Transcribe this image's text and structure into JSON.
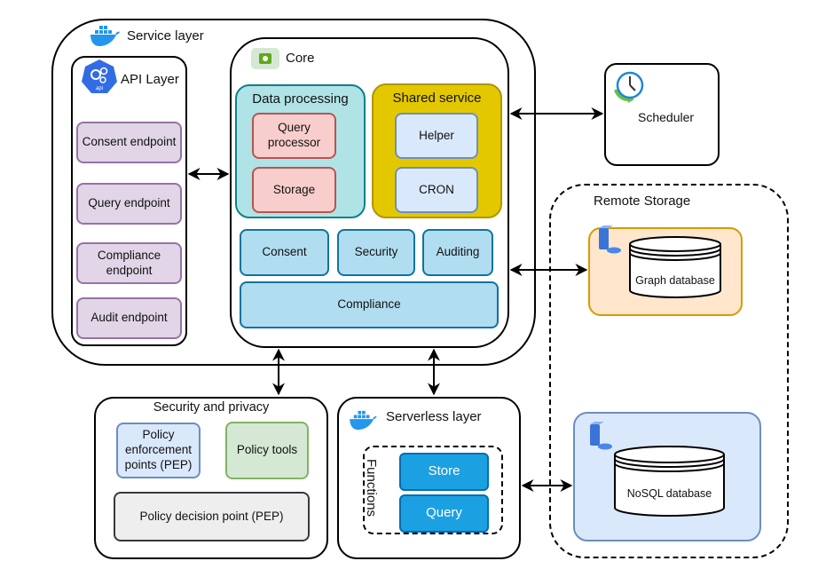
{
  "service_layer": {
    "title": "Service layer",
    "icon": "docker-whale-icon",
    "api_layer": {
      "title": "API Layer",
      "icon": "api-gears-icon",
      "endpoints": [
        "Consent endpoint",
        "Query endpoint",
        "Compliance endpoint",
        "Audit endpoint"
      ]
    },
    "core": {
      "title": "Core",
      "icon": "core-chip-icon",
      "data_processing": {
        "title": "Data processing",
        "items": [
          "Query processor",
          "Storage"
        ]
      },
      "shared_service": {
        "title": "Shared service",
        "items": [
          "Helper",
          "CRON"
        ]
      },
      "modules": [
        "Consent",
        "Security",
        "Auditing"
      ],
      "compliance": "Compliance"
    }
  },
  "scheduler": {
    "label": "Scheduler",
    "icon": "clock-icon"
  },
  "remote_storage": {
    "title": "Remote Storage",
    "graph_db": {
      "label": "Graph database",
      "icon": "server-db-icon"
    },
    "nosql_db": {
      "label": "NoSQL database",
      "icon": "server-db-icon"
    }
  },
  "security_privacy": {
    "title": "Security and privacy",
    "pep": "Policy enforcement points (PEP)",
    "tools": "Policy tools",
    "pdp": "Policy decision point (PEP)"
  },
  "serverless": {
    "title": "Serverless layer",
    "icon": "docker-whale-icon",
    "functions_label": "Functions",
    "functions": [
      "Store",
      "Query"
    ]
  },
  "colors": {
    "api_endpoint": "#e1d5e7",
    "data_processing": "#b0e3e6",
    "shared_service": "#e3c800",
    "core_module": "#b1ddf0",
    "graph_db": "#ffe6cc",
    "nosql_db": "#dae8fc",
    "function": "#1ba1e2"
  }
}
